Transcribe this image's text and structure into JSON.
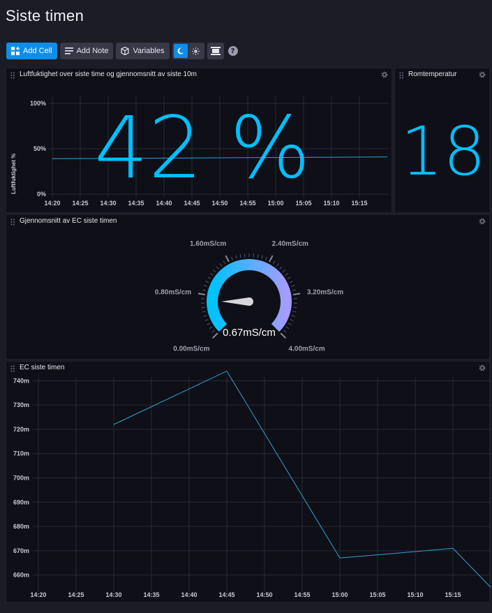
{
  "page": {
    "title": "Siste timen"
  },
  "toolbar": {
    "add_cell": "Add Cell",
    "add_note": "Add Note",
    "variables": "Variables",
    "help": "?"
  },
  "colors": {
    "accent": "#0e8ee8",
    "value_blue": "#00bfff",
    "line": "#2fa3d4",
    "gauge_start": "#00c2ff",
    "gauge_end": "#a59cff"
  },
  "humidity": {
    "title": "Luftfuktighet over siste time og gjennomsnitt av siste 10m",
    "big_value": "42 %",
    "ylabel": "Luftfuktighet %",
    "yticks": [
      "100%",
      "50%",
      "0%"
    ],
    "xticks": [
      "14:20",
      "14:25",
      "14:30",
      "14:35",
      "14:40",
      "14:45",
      "14:50",
      "14:55",
      "15:00",
      "15:05",
      "15:10",
      "15:15"
    ]
  },
  "room": {
    "title": "Romtemperatur",
    "value": "18"
  },
  "gauge": {
    "title": "Gjennomsnitt av EC siste timen",
    "value_label": "0.67mS/cm",
    "value": 0.67,
    "min": 0,
    "max": 4,
    "labels": [
      "0.00mS/cm",
      "0.80mS/cm",
      "1.60mS/cm",
      "2.40mS/cm",
      "3.20mS/cm",
      "4.00mS/cm"
    ]
  },
  "ec": {
    "title": "EC siste timen"
  },
  "chart_data": [
    {
      "type": "line",
      "title": "Luftfuktighet over siste time og gjennomsnitt av siste 10m",
      "ylabel": "Luftfuktighet %",
      "ylim": [
        0,
        100
      ],
      "x": [
        "14:20",
        "15:20"
      ],
      "series": [
        {
          "values": [
            39,
            41
          ]
        }
      ],
      "grid": true
    },
    {
      "type": "line",
      "title": "EC siste timen",
      "ylim": [
        655,
        745
      ],
      "yticks": [
        "740m",
        "730m",
        "720m",
        "710m",
        "700m",
        "690m",
        "680m",
        "670m",
        "660m"
      ],
      "xticks": [
        "14:20",
        "14:25",
        "14:30",
        "14:35",
        "14:40",
        "14:45",
        "14:50",
        "14:55",
        "15:00",
        "15:05",
        "15:10",
        "15:15"
      ],
      "x": [
        "14:30",
        "14:45",
        "15:00",
        "15:15",
        "15:20"
      ],
      "series": [
        {
          "values": [
            722,
            744,
            667,
            671,
            655
          ]
        }
      ],
      "grid": true
    }
  ]
}
